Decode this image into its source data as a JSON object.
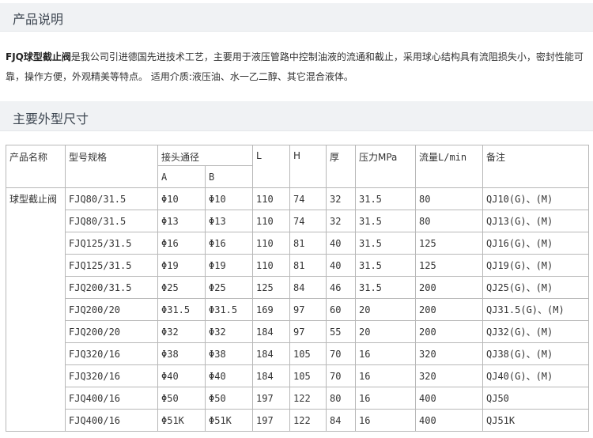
{
  "section1": {
    "title": "产品说明"
  },
  "intro": {
    "bold": "FJQ球型截止阀",
    "text": "是我公司引进德国先进技术工艺，主要用于液压管路中控制油液的流通和截止，采用球心结构具有流阻损失小，密封性能可靠，操作方便，外观精美等特点。 适用介质:液压油、水一乙二醇、其它混合液体。"
  },
  "section2": {
    "title": "主要外型尺寸"
  },
  "table": {
    "headers": {
      "name": "产品名称",
      "model": "型号规格",
      "port": "接头通径",
      "port_a": "A",
      "port_b": "B",
      "L": "L",
      "H": "H",
      "thick": "厚",
      "pressure": "压力MPa",
      "flow": "流量L/min",
      "note": "备注"
    },
    "product_name": "球型截止阀",
    "rows": [
      [
        "FJQ80/31.5",
        "Φ10",
        "Φ10",
        "110",
        "74",
        "32",
        "31.5",
        "80",
        "QJ10(G)、(M)"
      ],
      [
        "FJQ80/31.5",
        "Φ13",
        "Φ13",
        "110",
        "74",
        "32",
        "31.5",
        "80",
        "QJ13(G)、(M)"
      ],
      [
        "FJQ125/31.5",
        "Φ16",
        "Φ16",
        "110",
        "81",
        "40",
        "31.5",
        "125",
        "QJ16(G)、(M)"
      ],
      [
        "FJQ125/31.5",
        "Φ19",
        "Φ19",
        "110",
        "81",
        "40",
        "31.5",
        "125",
        "QJ19(G)、(M)"
      ],
      [
        "FJQ200/31.5",
        "Φ25",
        "Φ25",
        "125",
        "84",
        "46",
        "31.5",
        "200",
        "QJ25(G)、(M)"
      ],
      [
        "FJQ200/20",
        "Φ31.5",
        "Φ31.5",
        "169",
        "97",
        "60",
        "20",
        "200",
        "QJ31.5(G)、(M)"
      ],
      [
        "FJQ200/20",
        "Φ32",
        "Φ32",
        "184",
        "97",
        "55",
        "20",
        "200",
        "QJ32(G)、(M)"
      ],
      [
        "FJQ320/16",
        "Φ38",
        "Φ38",
        "184",
        "105",
        "70",
        "16",
        "320",
        "QJ38(G)、(M)"
      ],
      [
        "FJQ320/16",
        "Φ40",
        "Φ40",
        "184",
        "105",
        "70",
        "16",
        "320",
        "QJ40(G)、(M)"
      ],
      [
        "FJQ400/16",
        "Φ50",
        "Φ50",
        "197",
        "122",
        "80",
        "16",
        "400",
        "QJ50"
      ],
      [
        "FJQ400/16",
        "Φ51K",
        "Φ51K",
        "197",
        "122",
        "84",
        "16",
        "400",
        "QJ51K"
      ]
    ]
  }
}
